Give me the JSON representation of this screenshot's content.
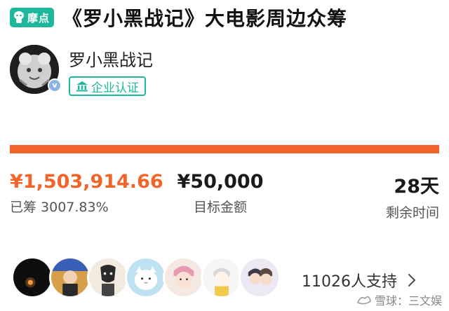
{
  "header": {
    "brand": "摩点",
    "title": "《罗小黑战记》大电影周边众筹"
  },
  "creator": {
    "name": "罗小黑战记",
    "badge": "企业认证",
    "verified_mark": "v"
  },
  "progress": {
    "fill_fraction": 1.0
  },
  "stats": {
    "raised_amount": "¥1,503,914.66",
    "raised_label": "已筹 3007.83%",
    "goal_amount": "¥50,000",
    "goal_label": "目标金额",
    "days_left": "28天",
    "days_label": "剩余时间"
  },
  "supporters": {
    "count_label": "11026人支持",
    "avatars": [
      "supporter-1",
      "supporter-2",
      "supporter-3",
      "supporter-4",
      "supporter-5",
      "supporter-6",
      "supporter-7"
    ]
  },
  "watermark": {
    "text": "雪球：三文娱"
  },
  "colors": {
    "brand_green": "#1db89c",
    "accent_orange": "#f1652b",
    "progress_track": "#f2e1d8"
  }
}
